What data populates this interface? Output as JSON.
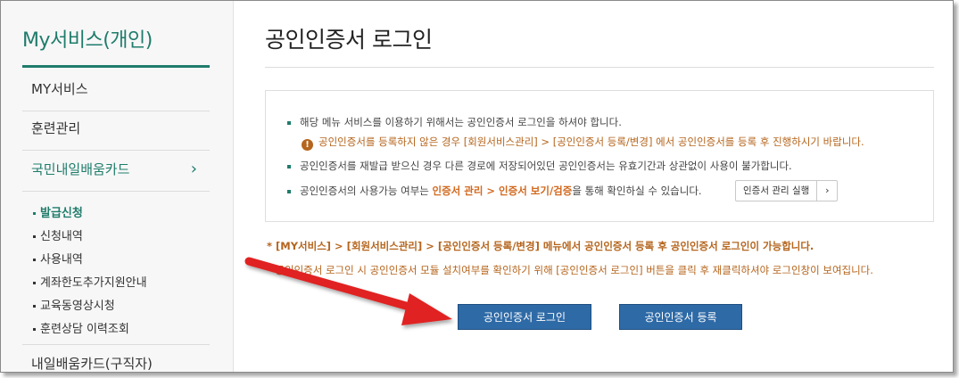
{
  "sidebar": {
    "title": "My서비스(개인)",
    "items": [
      {
        "label": "MY서비스"
      },
      {
        "label": "훈련관리"
      },
      {
        "label": "국민내일배움카드",
        "chevron": "›"
      }
    ],
    "sub_items": [
      {
        "label": "발급신청"
      },
      {
        "label": "신청내역"
      },
      {
        "label": "사용내역"
      },
      {
        "label": "계좌한도추가지원안내"
      },
      {
        "label": "교육동영상시청"
      },
      {
        "label": "훈련상담 이력조회"
      }
    ],
    "bottom_item": "내일배움카드(구직자)"
  },
  "main": {
    "title": "공인인증서 로그인",
    "info": {
      "line1": "해당 메뉴 서비스를 이용하기 위해서는 공인인증서 로그인을 하셔야 합니다.",
      "warning": "공인인증서를 등록하지 않은 경우 [회원서비스관리] > [공인인증서 등록/변경] 에서 공인인증서를 등록 후 진행하시기 바랍니다.",
      "warning_icon": "!",
      "line2": "공인인증서를 재발급 받으신 경우 다른 경로에 저장되어있던 공인인증서는 유효기간과 상관없이 사용이 불가합니다.",
      "line3_pre": "공인인증서의 사용가능 여부는",
      "line3_hl": "인증서 관리 > 인증서 보기/검증",
      "line3_post": "을 통해 확인하실 수 있습니다.",
      "mgr_button": "인증서 관리 실행",
      "mgr_arrow": "›"
    },
    "note1": "* [MY서비스] > [회원서비스관리] > [공인인증서 등록/변경] 메뉴에서 공인인증서 등록 후 공인인증서 로그인이 가능합니다.",
    "note2": "* 공인인증서 로그인 시 공인인증서 모듈 설치여부를 확인하기 위해 [공인인증서 로그인] 버튼을 클릭 후 재클릭하셔야 로그인창이 보여집니다.",
    "login_button": "공인인증서 로그인",
    "register_button": "공인인증서 등록"
  },
  "colors": {
    "brand": "#1f7c6b",
    "button": "#2e6aa6",
    "warning": "#b5651d",
    "annotation_arrow": "#e02020"
  }
}
